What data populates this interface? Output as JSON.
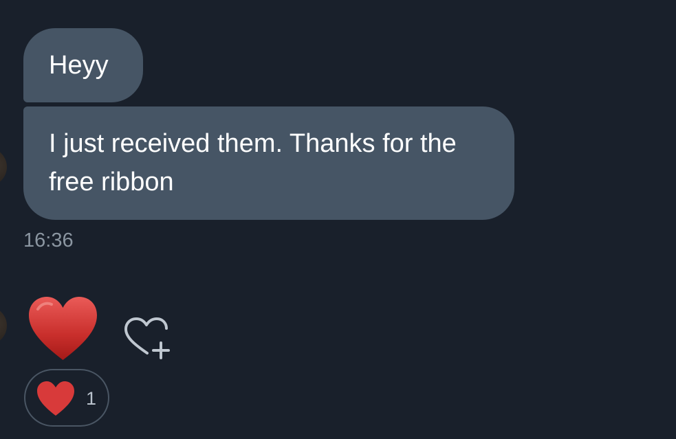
{
  "messages": [
    {
      "text": "Heyy"
    },
    {
      "text": "I just received them. Thanks for the free ribbon"
    }
  ],
  "timestamp": "16:36",
  "reaction": {
    "emoji_icon": "red-heart-icon",
    "count": "1"
  },
  "add_reaction_icon": "heart-plus-icon",
  "colors": {
    "background": "#19202b",
    "bubble": "#465565",
    "text": "#ffffff",
    "timestamp": "#8b96a1",
    "heart": "#d83a3a"
  }
}
